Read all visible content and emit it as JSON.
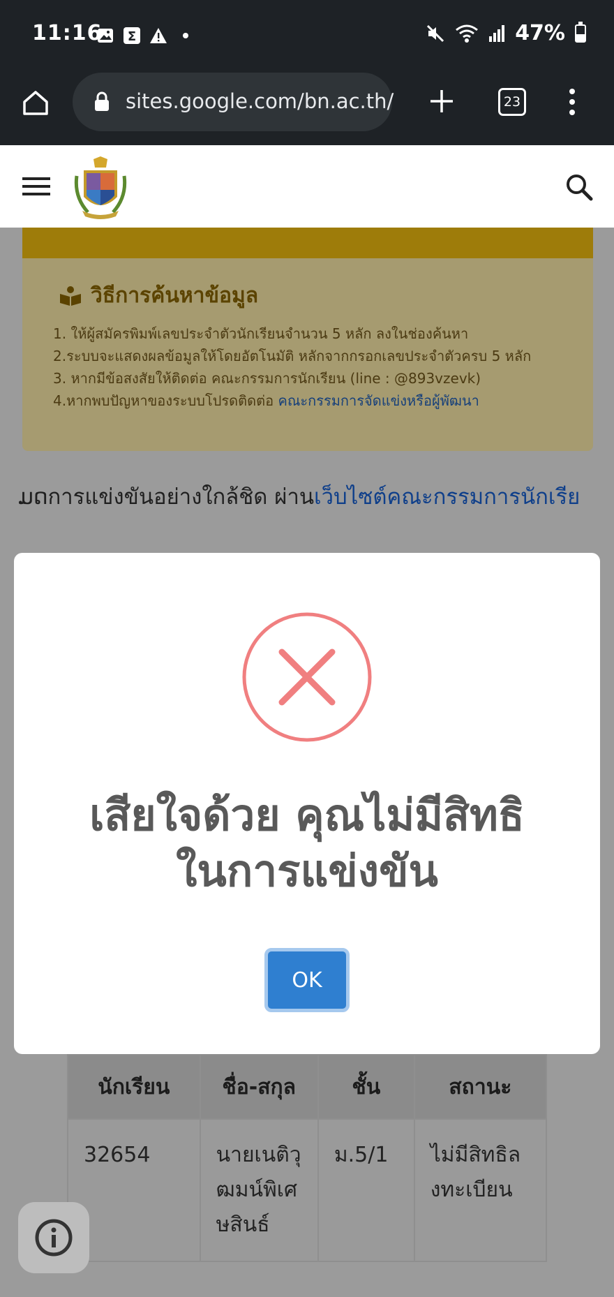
{
  "status_bar": {
    "time": "11:16",
    "battery": "47%",
    "icons": [
      "image-icon",
      "sigma-icon",
      "warning-icon",
      "dot-icon",
      "mute-icon",
      "wifi-icon",
      "signal-icon",
      "battery-icon"
    ]
  },
  "browser": {
    "url": "sites.google.com/bn.ac.th/",
    "tab_count": "23"
  },
  "page": {
    "info_title": "วิธีการค้นหาข้อมูล",
    "info_lines": [
      "1. ให้ผู้สมัครพิมพ์เลขประจำตัวนักเรียนจำนวน 5 หลัก ลงในช่องค้นหา",
      "2.ระบบจะแสดงผลข้อมูลให้โดยอัตโนมัติ หลักจากกรอกเลขประจำตัวครบ 5 หลัก",
      "3. หากมีข้อสงสัยให้ติดต่อ คณะกรรมการนักเรียน (line : @893vzevk)",
      "4.หากพบปัญหาของระบบโปรดติดต่อ "
    ],
    "info_link": "คณะกรรมการจัดแข่งหรือผู้พัฒนา",
    "marquee_text": "ມດการแข่งขันอย่างใกล้ชิด ผ่าน",
    "marquee_link": "เว็บไซต์คณะกรรมการนักเรีย",
    "table": {
      "headers": [
        "นักเรียน",
        "ชื่อ-สกุล",
        "ชั้น",
        "สถานะ"
      ],
      "rows": [
        {
          "id": "32654",
          "name": "นายเนติวุฒมน์พิเศษสินธ์",
          "class": "ม.5/1",
          "status": "ไม่มีสิทธิลงทะเบียน"
        }
      ]
    }
  },
  "modal": {
    "title_line1": "เสียใจด้วย คุณไม่มีสิทธิ",
    "title_line2": "ในการแข่งขัน",
    "ok_label": "OK",
    "icon": "error-x-icon"
  },
  "colors": {
    "error": "#f07f80",
    "button": "#2f7fd0",
    "browser_bg": "#1e2226"
  }
}
